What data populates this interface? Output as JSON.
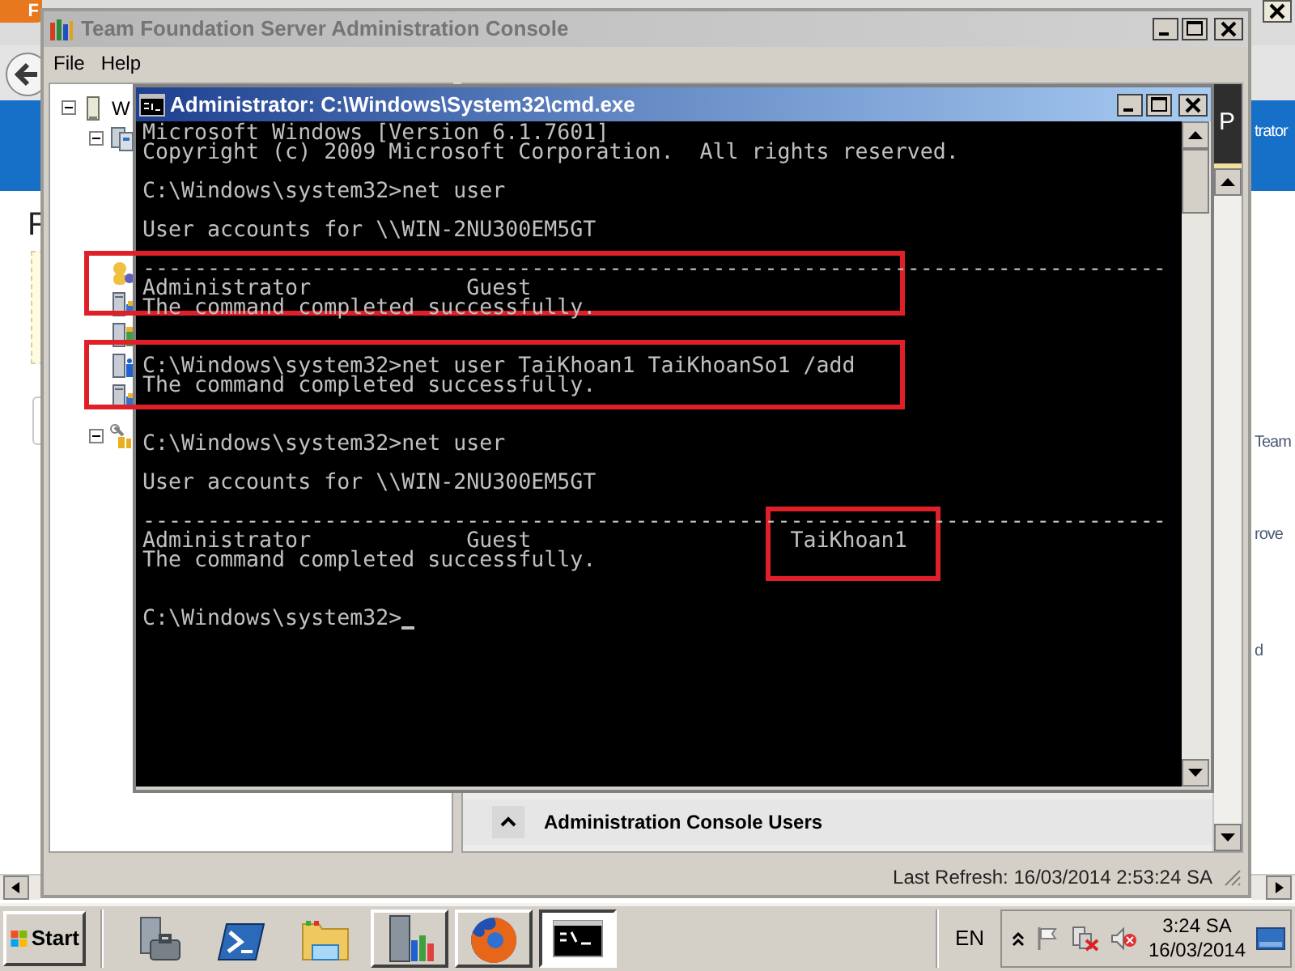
{
  "browser": {
    "menu_button": "F",
    "header_text": "trator",
    "heading": "F",
    "side_texts": [
      "Team",
      "rove",
      "d"
    ]
  },
  "admin_console": {
    "title": "Team Foundation Server Administration Console",
    "menu": [
      "File",
      "Help"
    ],
    "tree": [
      {
        "label": "W",
        "expanded": true,
        "children": [
          {
            "kind": "server-group",
            "expanded": true,
            "children": [
              {
                "kind": "users"
              },
              {
                "kind": "server"
              },
              {
                "kind": "server-green"
              },
              {
                "kind": "server-info"
              },
              {
                "kind": "server"
              }
            ]
          },
          {
            "kind": "tools",
            "expanded": true
          }
        ]
      }
    ],
    "pane_header": "P",
    "section": {
      "title": "Administration Console Users",
      "expanded": true
    },
    "status": "Last Refresh: 16/03/2014 2:53:24 SA"
  },
  "cmd": {
    "title": "Administrator: C:\\Windows\\System32\\cmd.exe",
    "lines": [
      {
        "kind": "text",
        "text": "Microsoft Windows [Version 6.1.7601]"
      },
      {
        "kind": "text",
        "text": "Copyright (c) 2009 Microsoft Corporation.  All rights reserved."
      },
      {
        "kind": "blank"
      },
      {
        "kind": "text",
        "text": "C:\\Windows\\system32>net user"
      },
      {
        "kind": "blank"
      },
      {
        "kind": "text",
        "text": "User accounts for \\\\WIN-2NU300EM5GT"
      },
      {
        "kind": "blank"
      },
      {
        "kind": "text",
        "text": "-------------------------------------------------------------------------------"
      },
      {
        "kind": "text",
        "text": "Administrator            Guest"
      },
      {
        "kind": "text",
        "text": "The command completed successfully."
      },
      {
        "kind": "blank"
      },
      {
        "kind": "blank"
      },
      {
        "kind": "text",
        "text": "C:\\Windows\\system32>net user TaiKhoan1 TaiKhoanSo1 /add"
      },
      {
        "kind": "text",
        "text": "The command completed successfully."
      },
      {
        "kind": "blank"
      },
      {
        "kind": "blank"
      },
      {
        "kind": "text",
        "text": "C:\\Windows\\system32>net user"
      },
      {
        "kind": "blank"
      },
      {
        "kind": "text",
        "text": "User accounts for \\\\WIN-2NU300EM5GT"
      },
      {
        "kind": "blank"
      },
      {
        "kind": "text",
        "text": "-------------------------------------------------------------------------------"
      },
      {
        "kind": "text",
        "text": "Administrator            Guest                    TaiKhoan1"
      },
      {
        "kind": "text",
        "text": "The command completed successfully."
      },
      {
        "kind": "blank"
      },
      {
        "kind": "blank"
      },
      {
        "kind": "prompt",
        "text": "C:\\Windows\\system32>",
        "cursor": true
      }
    ]
  },
  "taskbar": {
    "start": "Start",
    "apps": [
      {
        "kind": "server-tools",
        "open": false,
        "active": false
      },
      {
        "kind": "powershell",
        "open": false,
        "active": false
      },
      {
        "kind": "folder",
        "open": false,
        "active": false
      },
      {
        "kind": "server-chart",
        "open": true,
        "active": false
      },
      {
        "kind": "firefox",
        "open": true,
        "active": false
      },
      {
        "kind": "cmd",
        "open": true,
        "active": true
      }
    ],
    "language": "EN",
    "time": "3:24 SA",
    "date": "16/03/2014"
  }
}
